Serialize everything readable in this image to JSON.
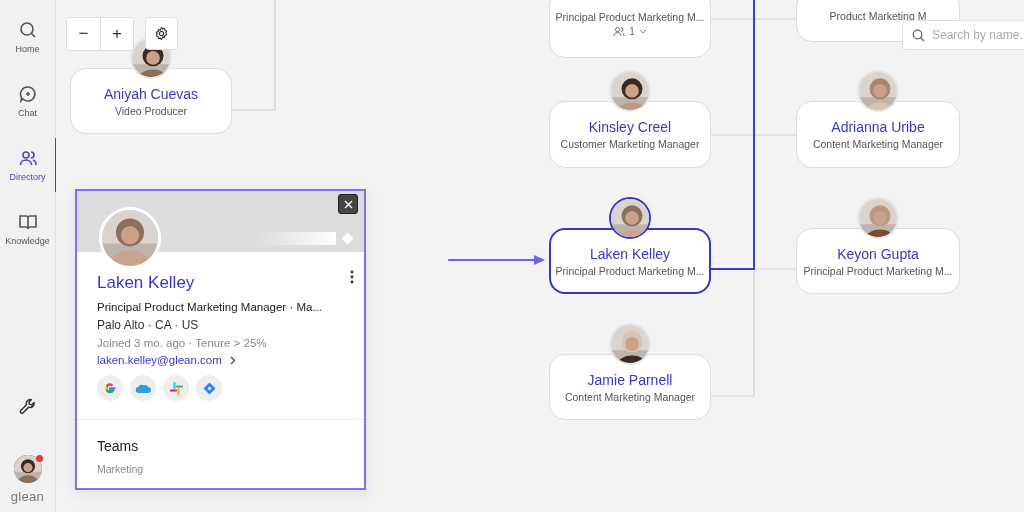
{
  "sidebar": {
    "items": [
      {
        "label": "Home",
        "selected": false
      },
      {
        "label": "Chat",
        "selected": false
      },
      {
        "label": "Directory",
        "selected": true
      },
      {
        "label": "Knowledge",
        "selected": false
      }
    ],
    "user": {
      "notification": true
    },
    "logo": "glean"
  },
  "canvas": {
    "zoom_controls": [
      "−",
      "+"
    ],
    "search": {
      "placeholder": "Search by name.."
    },
    "nodes": [
      {
        "title": "Principal Product Marketing M...",
        "reports": "1",
        "avatar": false,
        "selected": false
      },
      {
        "title": "Product Marketing M",
        "avatar": false,
        "selected": false
      },
      {
        "name": "Aniyah Cuevas",
        "title": "Video Producer",
        "avatar": true,
        "selected": false
      },
      {
        "name": "Kinsley Creel",
        "title": "Customer Marketing Manager",
        "avatar": true,
        "selected": false
      },
      {
        "name": "Adrianna Uribe",
        "title": "Content Marketing Manager",
        "avatar": true,
        "selected": false
      },
      {
        "name": "Laken Kelley",
        "title": "Principal Product Marketing M...",
        "avatar": true,
        "selected": true
      },
      {
        "name": "Keyon Gupta",
        "title": "Principal Product Marketing M...",
        "avatar": true,
        "selected": false
      },
      {
        "name": "Jamie Parnell",
        "title": "Content Marketing Manager",
        "avatar": true,
        "selected": false
      }
    ]
  },
  "profile": {
    "name": "Laken Kelley",
    "title": "Principal Product Marketing Manager · Ma...",
    "location": "Palo Alto · CA · US",
    "joined": "Joined 3 mo. ago · Tenure > 25%",
    "email": "laken.kelley@glean.com",
    "apps": [
      {
        "kind": "google"
      },
      {
        "kind": "salesforce"
      },
      {
        "kind": "slack"
      },
      {
        "kind": "jira"
      }
    ],
    "teams_heading": "Teams",
    "teams": [
      "Marketing"
    ]
  }
}
